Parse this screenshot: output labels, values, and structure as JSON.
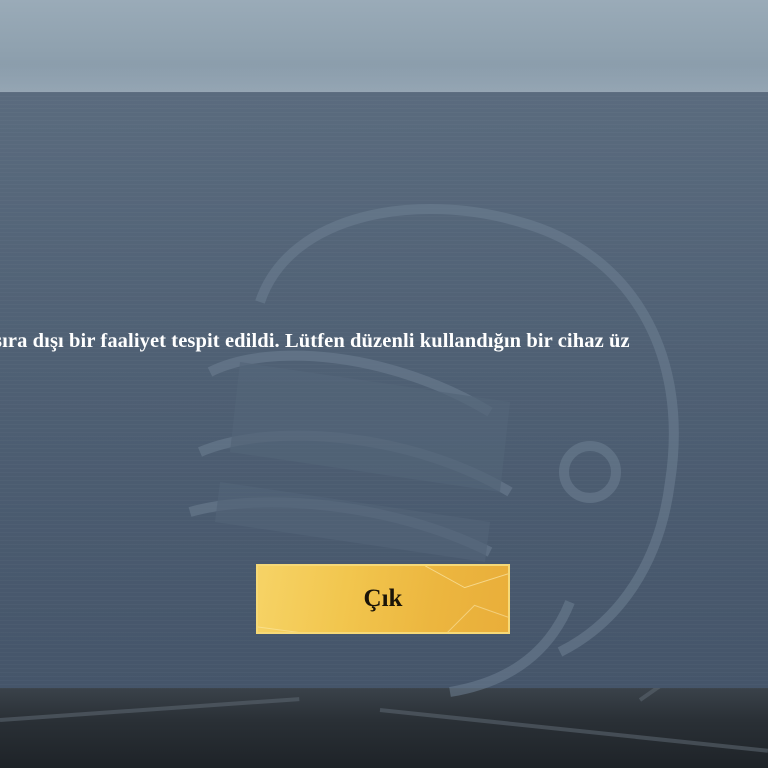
{
  "dialog": {
    "message": "sıra dışı bir faaliyet tespit edildi. Lütfen düzenli kullandığın bir cihaz üz",
    "exit_label": "Çık"
  },
  "background": {
    "watermark_icon": "helmet-icon"
  },
  "colors": {
    "panel": "#4f6074",
    "button_gold": "#f2c64e",
    "button_border": "#f6d977",
    "button_text": "#1a1408",
    "message_text": "#ffffff"
  }
}
